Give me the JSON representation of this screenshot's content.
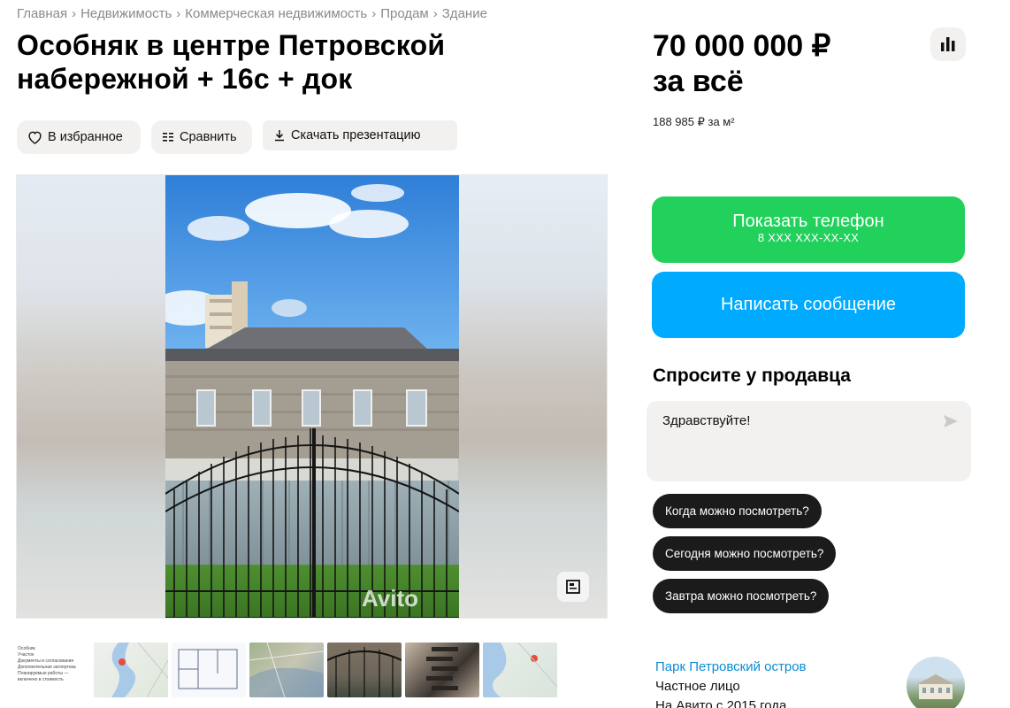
{
  "breadcrumb": [
    "Главная",
    "Недвижимость",
    "Коммерческая недвижимость",
    "Продам",
    "Здание"
  ],
  "breadcrumb_separator": "›",
  "listing": {
    "title": "Особняк в центре Петровской набережной + 16с + док"
  },
  "actions": {
    "favorite": "В избранное",
    "compare": "Сравнить",
    "download": "Скачать презентацию"
  },
  "gallery": {
    "watermark": "Avito",
    "thumb_doc_lines": [
      "Особняк",
      "Участок",
      "Документы и согласования",
      "Дополнительная экспертиза",
      "Планируемые работы — включено в стоимость"
    ]
  },
  "price": {
    "amount": "70 000 000 ₽",
    "suffix": "за всё",
    "per_m2": "188 985 ₽ за м²"
  },
  "contact": {
    "show_phone": "Показать телефон",
    "phone_mask": "8 XXX XXX-XX-XX",
    "write_message": "Написать сообщение"
  },
  "ask": {
    "title": "Спросите у продавца",
    "input_value": "Здравствуйте!",
    "chips": [
      "Когда можно посмотреть?",
      "Сегодня можно посмотреть?",
      "Завтра можно посмотреть?"
    ]
  },
  "seller": {
    "name": "Парк Петровский остров",
    "type": "Частное лицо",
    "since": "На Авито с 2015 года"
  },
  "colors": {
    "green": "#21d15b",
    "blue": "#00aaff",
    "link": "#0a8cd6"
  }
}
